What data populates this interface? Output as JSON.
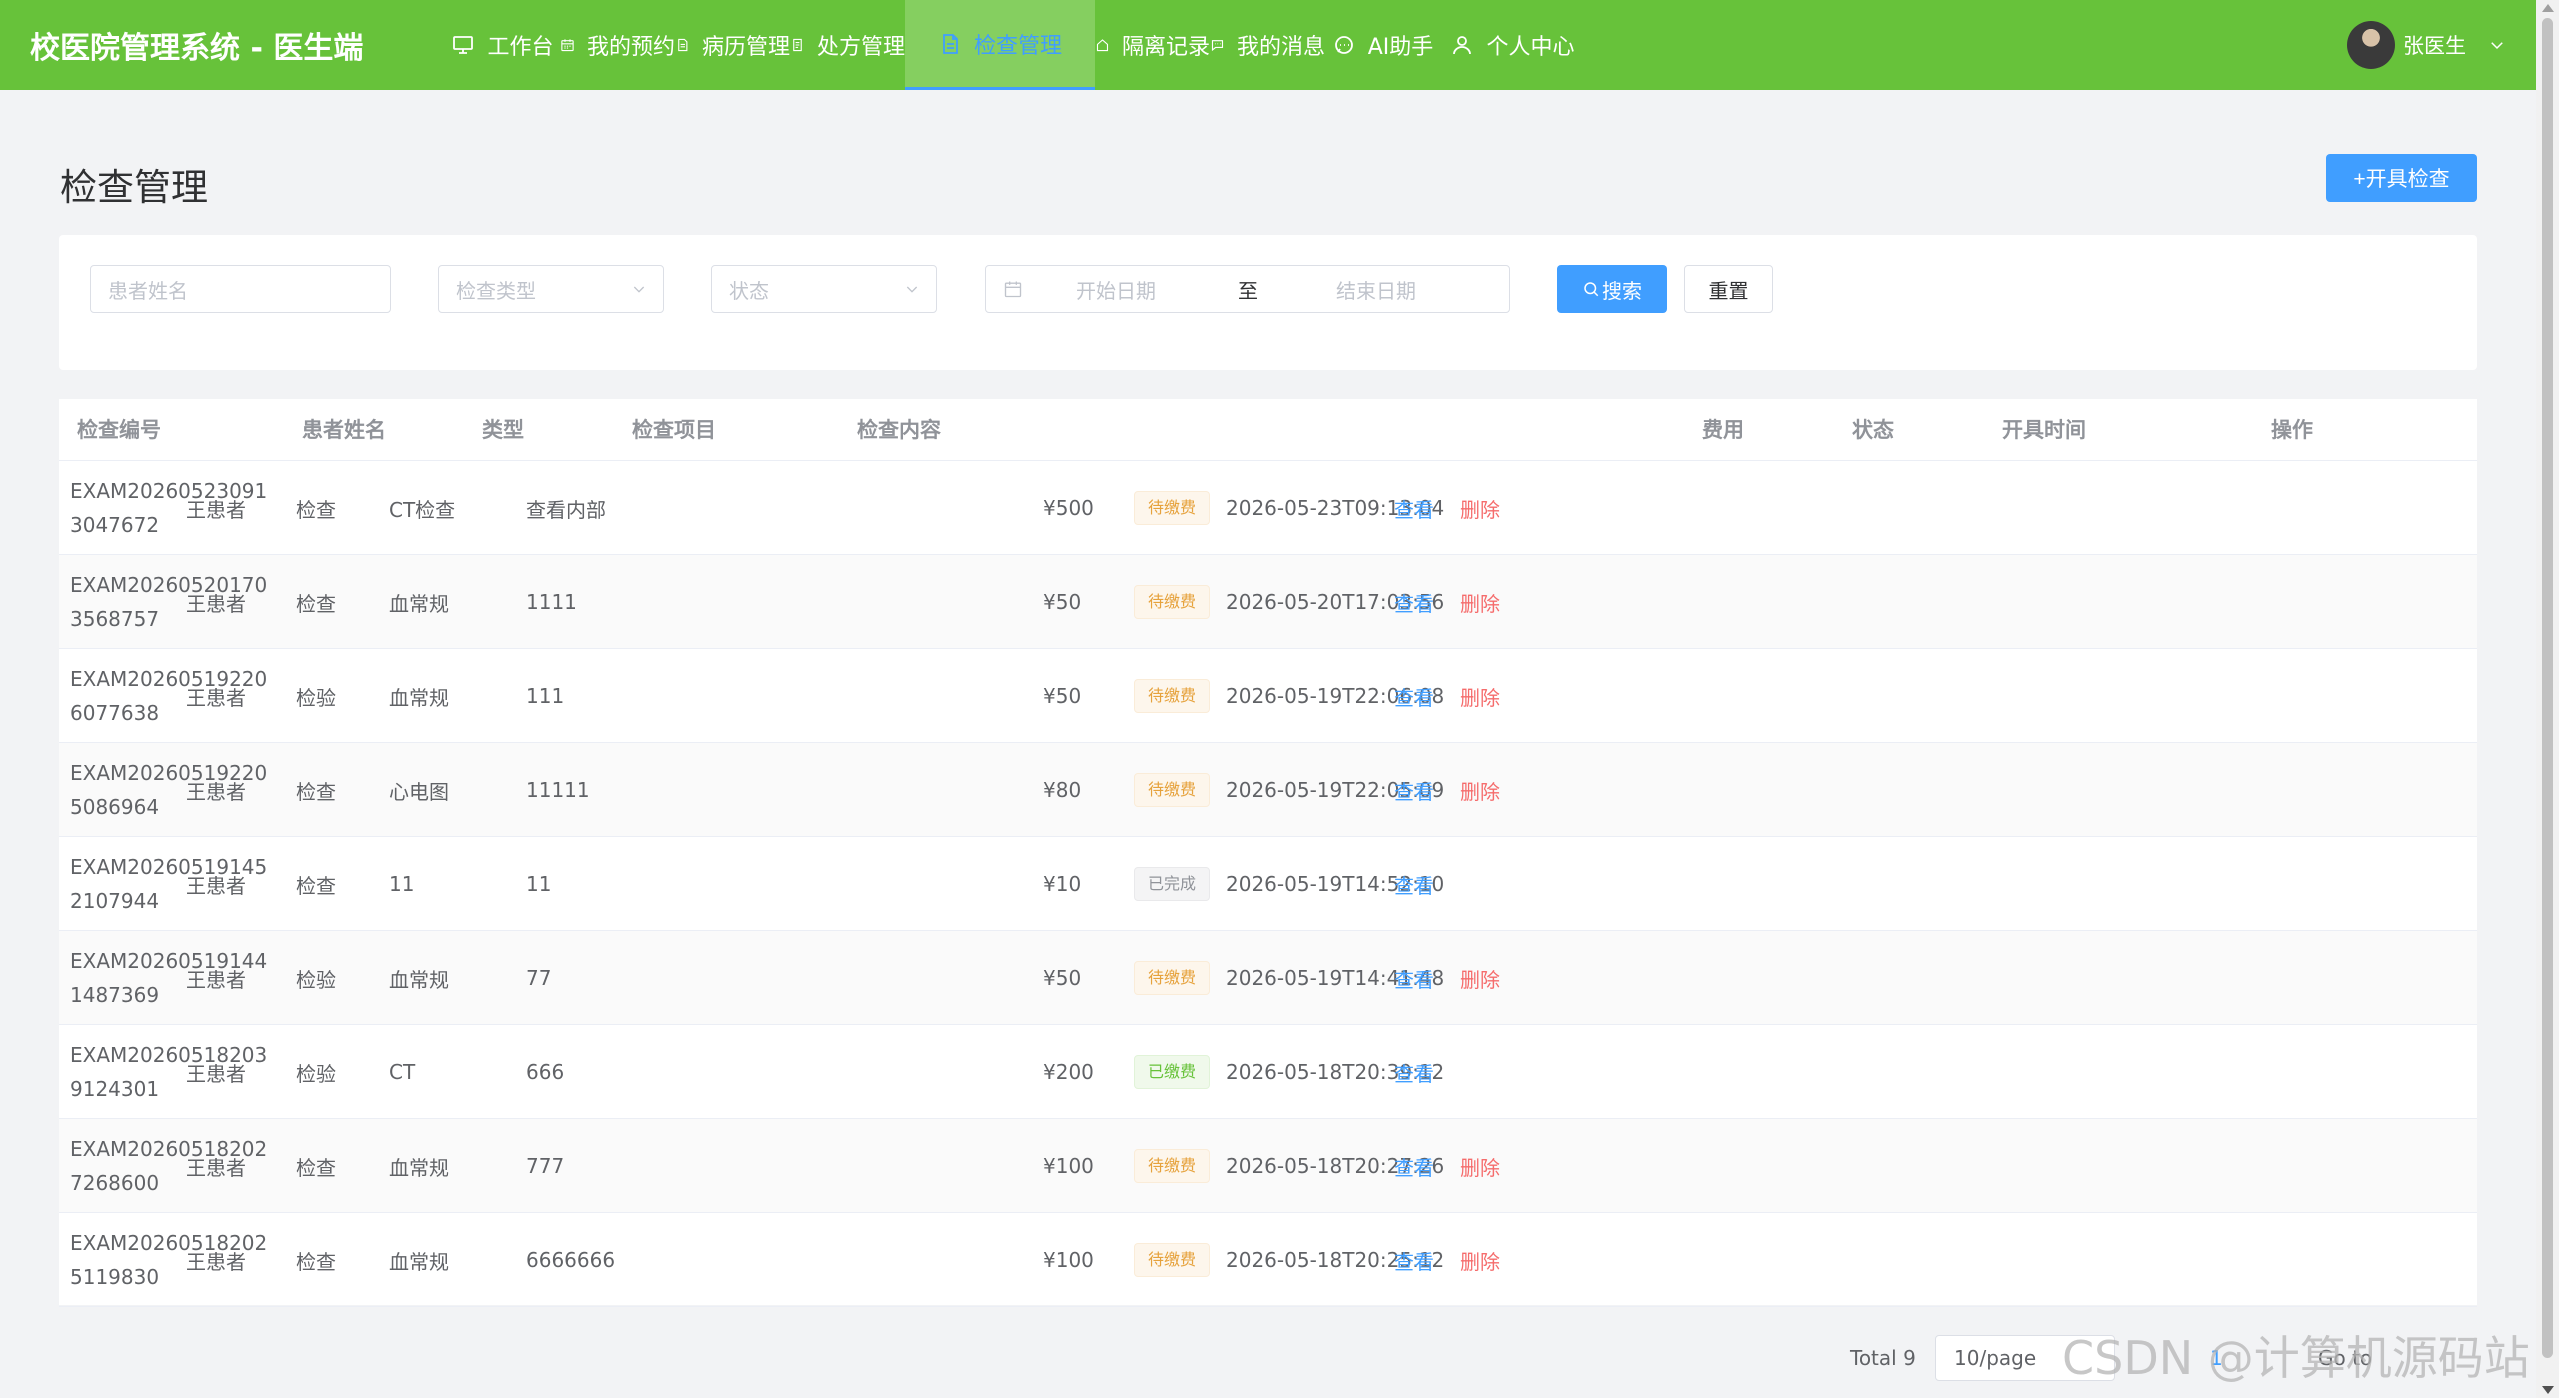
{
  "header": {
    "brand": "校医院管理系统 - 医生端",
    "nav": [
      {
        "label": "工作台",
        "icon": "monitor-icon",
        "active": false
      },
      {
        "label": "我的预约",
        "icon": "calendar-icon",
        "active": false
      },
      {
        "label": "病历管理",
        "icon": "document-icon",
        "active": false
      },
      {
        "label": "处方管理",
        "icon": "prescription-icon",
        "active": false
      },
      {
        "label": "检查管理",
        "icon": "file-icon",
        "active": true
      },
      {
        "label": "隔离记录",
        "icon": "house-icon",
        "active": false
      },
      {
        "label": "我的消息",
        "icon": "chat-icon",
        "active": false
      },
      {
        "label": "AI助手",
        "icon": "chat-bubble-icon",
        "active": false
      },
      {
        "label": "个人中心",
        "icon": "user-icon",
        "active": false
      }
    ],
    "user_name": "张医生"
  },
  "page": {
    "title": "检查管理",
    "create_button": "+开具检查"
  },
  "filters": {
    "patient_placeholder": "患者姓名",
    "type_placeholder": "检查类型",
    "status_placeholder": "状态",
    "start_placeholder": "开始日期",
    "range_separator": "至",
    "end_placeholder": "结束日期",
    "search_button": "搜索",
    "reset_button": "重置"
  },
  "table": {
    "columns": [
      "检查编号",
      "患者姓名",
      "类型",
      "检查项目",
      "检查内容",
      "费用",
      "状态",
      "开具时间",
      "操作"
    ],
    "view_label": "查看",
    "delete_label": "删除",
    "rows": [
      {
        "code": "EXAM202605230913047672",
        "patient": "王患者",
        "type": "检查",
        "item": "CT检查",
        "content": "查看内部",
        "fee": "¥500",
        "status": "待缴费",
        "status_kind": "pending",
        "time": "2026-05-23T09:13:04",
        "can_delete": true
      },
      {
        "code": "EXAM202605201703568757",
        "patient": "王患者",
        "type": "检查",
        "item": "血常规",
        "content": "1111",
        "fee": "¥50",
        "status": "待缴费",
        "status_kind": "pending",
        "time": "2026-05-20T17:03:56",
        "can_delete": true
      },
      {
        "code": "EXAM202605192206077638",
        "patient": "王患者",
        "type": "检验",
        "item": "血常规",
        "content": "111",
        "fee": "¥50",
        "status": "待缴费",
        "status_kind": "pending",
        "time": "2026-05-19T22:06:08",
        "can_delete": true
      },
      {
        "code": "EXAM202605192205086964",
        "patient": "王患者",
        "type": "检查",
        "item": "心电图",
        "content": "11111",
        "fee": "¥80",
        "status": "待缴费",
        "status_kind": "pending",
        "time": "2026-05-19T22:05:09",
        "can_delete": true
      },
      {
        "code": "EXAM202605191452107944",
        "patient": "王患者",
        "type": "检查",
        "item": "11",
        "content": "11",
        "fee": "¥10",
        "status": "已完成",
        "status_kind": "done",
        "time": "2026-05-19T14:52:10",
        "can_delete": false
      },
      {
        "code": "EXAM202605191441487369",
        "patient": "王患者",
        "type": "检验",
        "item": "血常规",
        "content": "77",
        "fee": "¥50",
        "status": "待缴费",
        "status_kind": "pending",
        "time": "2026-05-19T14:41:48",
        "can_delete": true
      },
      {
        "code": "EXAM202605182039124301",
        "patient": "王患者",
        "type": "检验",
        "item": "CT",
        "content": "666",
        "fee": "¥200",
        "status": "已缴费",
        "status_kind": "paid",
        "time": "2026-05-18T20:39:12",
        "can_delete": false
      },
      {
        "code": "EXAM202605182027268600",
        "patient": "王患者",
        "type": "检查",
        "item": "血常规",
        "content": "777",
        "fee": "¥100",
        "status": "待缴费",
        "status_kind": "pending",
        "time": "2026-05-18T20:27:26",
        "can_delete": true
      },
      {
        "code": "EXAM202605182025119830",
        "patient": "王患者",
        "type": "检查",
        "item": "血常规",
        "content": "6666666",
        "fee": "¥100",
        "status": "待缴费",
        "status_kind": "pending",
        "time": "2026-05-18T20:25:12",
        "can_delete": true
      }
    ]
  },
  "pagination": {
    "total": "Total 9",
    "page_size": "10/page",
    "current_page": "1",
    "goto": "Go to"
  },
  "watermark": "CSDN @计算机源码站",
  "colors": {
    "header": "#67c23a",
    "primary": "#409eff",
    "danger": "#f56c6c",
    "warning": "#e6a23c"
  }
}
